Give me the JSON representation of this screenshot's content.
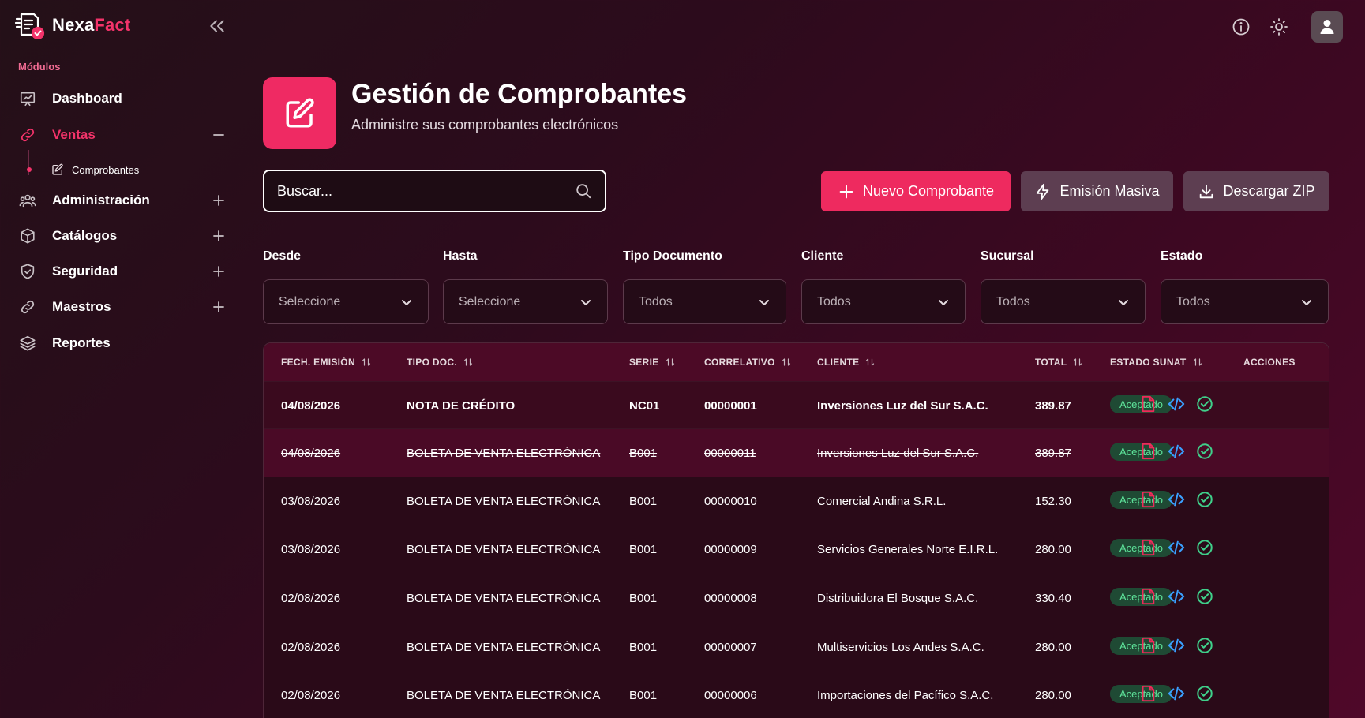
{
  "brand": {
    "part1": "Nexa",
    "part2": "Fact"
  },
  "sidebar": {
    "section_label": "Módulos",
    "items": [
      {
        "label": "Dashboard",
        "icon": "presentation-chart-icon"
      },
      {
        "label": "Ventas",
        "icon": "link-icon",
        "expanded": true
      },
      {
        "label": "Administración",
        "icon": "users-group-icon"
      },
      {
        "label": "Catálogos",
        "icon": "box-icon"
      },
      {
        "label": "Seguridad",
        "icon": "shield-icon"
      },
      {
        "label": "Maestros",
        "icon": "link-icon"
      },
      {
        "label": "Reportes",
        "icon": "layers-icon"
      }
    ],
    "sub_item": {
      "label": "Comprobantes",
      "icon": "edit-icon"
    }
  },
  "header": {
    "title": "Gestión de Comprobantes",
    "subtitle": "Administre sus comprobantes electrónicos"
  },
  "search": {
    "placeholder": "Buscar..."
  },
  "actions": {
    "new": "Nuevo Comprobante",
    "mass": "Emisión Masiva",
    "zip": "Descargar ZIP"
  },
  "filters": [
    {
      "label": "Desde",
      "value": "Seleccione"
    },
    {
      "label": "Hasta",
      "value": "Seleccione"
    },
    {
      "label": "Tipo Documento",
      "value": "Todos"
    },
    {
      "label": "Cliente",
      "value": "Todos"
    },
    {
      "label": "Sucursal",
      "value": "Todos"
    },
    {
      "label": "Estado",
      "value": "Todos"
    }
  ],
  "table": {
    "headers": [
      "FECH. EMISIÓN",
      "TIPO DOC.",
      "SERIE",
      "CORRELATIVO",
      "CLIENTE",
      "TOTAL",
      "ESTADO SUNAT",
      "ACCIONES"
    ],
    "rows": [
      {
        "fecha": "04/08/2026",
        "tipo": "NOTA DE CRÉDITO",
        "serie": "NC01",
        "correlativo": "00000001",
        "cliente": "Inversiones Luz del Sur S.A.C.",
        "total": "389.87",
        "estado": "Aceptado",
        "style": "bold"
      },
      {
        "fecha": "04/08/2026",
        "tipo": "BOLETA DE VENTA ELECTRÓNICA",
        "serie": "B001",
        "correlativo": "00000011",
        "cliente": "Inversiones Luz del Sur S.A.C.",
        "total": "389.87",
        "estado": "Aceptado",
        "style": "strike"
      },
      {
        "fecha": "03/08/2026",
        "tipo": "BOLETA DE VENTA ELECTRÓNICA",
        "serie": "B001",
        "correlativo": "00000010",
        "cliente": "Comercial Andina S.R.L.",
        "total": "152.30",
        "estado": "Aceptado",
        "style": "normal"
      },
      {
        "fecha": "03/08/2026",
        "tipo": "BOLETA DE VENTA ELECTRÓNICA",
        "serie": "B001",
        "correlativo": "00000009",
        "cliente": "Servicios Generales Norte E.I.R.L.",
        "total": "280.00",
        "estado": "Aceptado",
        "style": "normal"
      },
      {
        "fecha": "02/08/2026",
        "tipo": "BOLETA DE VENTA ELECTRÓNICA",
        "serie": "B001",
        "correlativo": "00000008",
        "cliente": "Distribuidora El Bosque S.A.C.",
        "total": "330.40",
        "estado": "Aceptado",
        "style": "normal"
      },
      {
        "fecha": "02/08/2026",
        "tipo": "BOLETA DE VENTA ELECTRÓNICA",
        "serie": "B001",
        "correlativo": "00000007",
        "cliente": "Multiservicios Los Andes S.A.C.",
        "total": "280.00",
        "estado": "Aceptado",
        "style": "normal"
      },
      {
        "fecha": "02/08/2026",
        "tipo": "BOLETA DE VENTA ELECTRÓNICA",
        "serie": "B001",
        "correlativo": "00000006",
        "cliente": "Importaciones del Pacífico S.A.C.",
        "total": "280.00",
        "estado": "Aceptado",
        "style": "normal"
      }
    ]
  },
  "colors": {
    "accent": "#ef2a63",
    "badge_text": "#5ee39a",
    "pdf_icon": "#ef2a5a",
    "xml_icon": "#3aa0ff",
    "cdr_icon": "#3fd08a"
  }
}
